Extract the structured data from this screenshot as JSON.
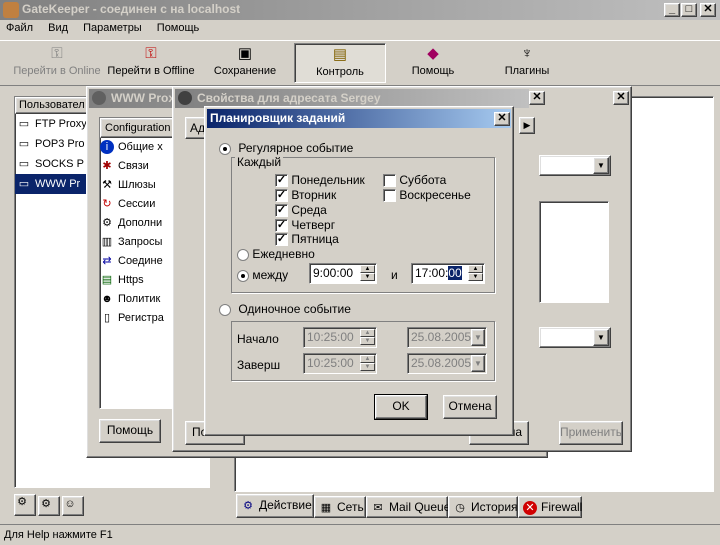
{
  "main_window": {
    "title": "GateKeeper - соединен с на localhost",
    "menu": [
      "Файл",
      "Вид",
      "Параметры",
      "Помощь"
    ],
    "toolbar": [
      {
        "label": "Перейти в Online",
        "icon": "key-icon",
        "disabled": true
      },
      {
        "label": "Перейти в Offline",
        "icon": "key-cross-icon",
        "disabled": false
      },
      {
        "label": "Сохранение",
        "icon": "floppy-icon",
        "disabled": false
      },
      {
        "label": "Контроль",
        "icon": "monitor-icon",
        "disabled": false,
        "pressed": true
      },
      {
        "label": "Помощь",
        "icon": "book-icon",
        "disabled": false
      },
      {
        "label": "Плагины",
        "icon": "plug-icon",
        "disabled": false
      }
    ],
    "users_header": "Пользовател",
    "users": [
      "FTP Proxy",
      "POP3 Pro",
      "SOCKS P",
      "WWW Pr"
    ],
    "bottom_tabs": [
      "Действие",
      "Сеть",
      "Mail Queue",
      "История",
      "Firewall"
    ],
    "status": "Для Help нажмите F1",
    "apply_button": "Применить"
  },
  "proxy_window": {
    "title": "WWW Prox",
    "config_tab": "Configuration",
    "items": [
      "Общие х",
      "Связи",
      "Шлюзы",
      "Сессии",
      "Дополни",
      "Запросы",
      "Соедине",
      "Https",
      "Политик",
      "Регистра"
    ],
    "help_button": "Помощь"
  },
  "props_window": {
    "title": "Свойства для адресата Sergey",
    "tab_fragment": "Ад",
    "bottom_left_btn": "По",
    "bottom_right_btn": "на"
  },
  "scheduler": {
    "title": "Планировщик заданий",
    "regular_label": "Регулярное событие",
    "each_label": "Каждый",
    "days": [
      {
        "label": "Понедельник",
        "checked": true
      },
      {
        "label": "Вторник",
        "checked": true
      },
      {
        "label": "Среда",
        "checked": true
      },
      {
        "label": "Четверг",
        "checked": true
      },
      {
        "label": "Пятница",
        "checked": true
      },
      {
        "label": "Суббота",
        "checked": false
      },
      {
        "label": "Воскресенье",
        "checked": false
      }
    ],
    "daily_label": "Ежедневно",
    "between_label": "между",
    "from_time": "9:00:00",
    "and_label": "и",
    "to_time_prefix": "17:00:",
    "to_time_sel": "00",
    "single_label": "Одиночное событие",
    "start_label": "Начало",
    "start_time": "10:25:00",
    "start_date": "25.08.2005",
    "end_label": "Заверш",
    "end_time": "10:25:00",
    "end_date": "25.08.2005",
    "ok": "OK",
    "cancel": "Отмена"
  }
}
